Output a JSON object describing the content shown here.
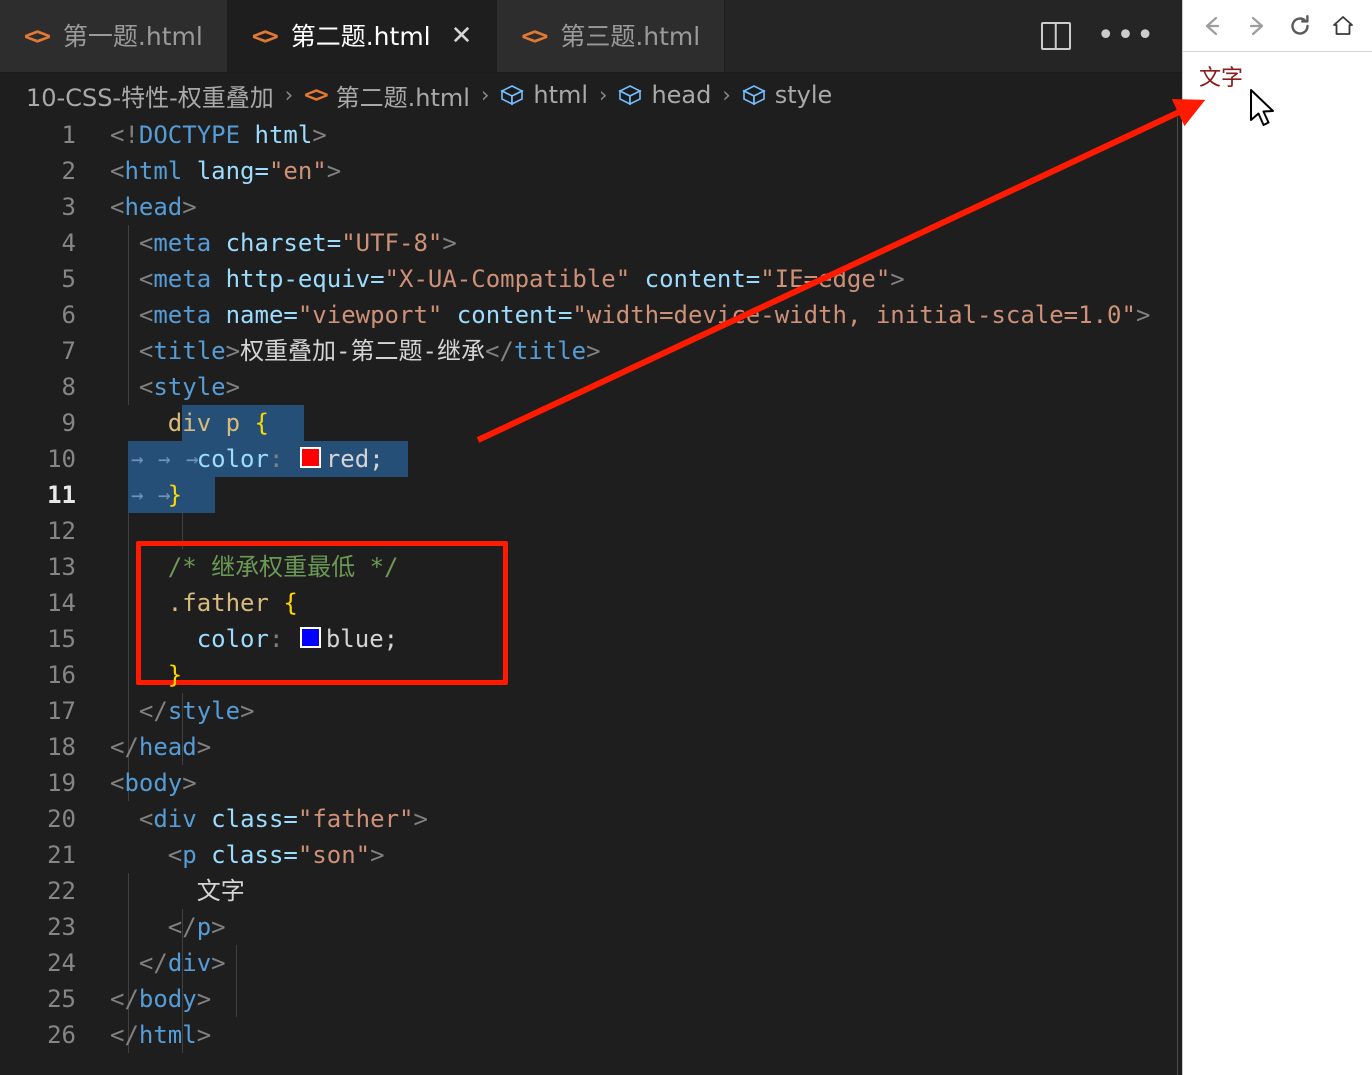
{
  "window": {
    "app": "Visual Studio Code"
  },
  "tabs": [
    {
      "label": "第一题.html",
      "icon": "html-code-icon",
      "active": false,
      "closable": false
    },
    {
      "label": "第二题.html",
      "icon": "html-code-icon",
      "active": true,
      "closable": true,
      "close_label": "✕"
    },
    {
      "label": "第三题.html",
      "icon": "html-code-icon",
      "active": false,
      "closable": false
    }
  ],
  "tabbar_actions": {
    "split_editor_label": "Split Editor",
    "more_actions_label": "•••"
  },
  "breadcrumb": {
    "separator": "›",
    "items": [
      {
        "label": "10-CSS-特性-权重叠加",
        "icon": "folder-icon"
      },
      {
        "label": "第二题.html",
        "icon": "html-code-icon"
      },
      {
        "label": "html",
        "icon": "symbol-cube-icon"
      },
      {
        "label": "head",
        "icon": "symbol-cube-icon"
      },
      {
        "label": "style",
        "icon": "symbol-cube-icon"
      }
    ]
  },
  "editor": {
    "current_line": 11,
    "line_numbers": [
      1,
      2,
      3,
      4,
      5,
      6,
      7,
      8,
      9,
      10,
      11,
      12,
      13,
      14,
      15,
      16,
      17,
      18,
      19,
      20,
      21,
      22,
      23,
      24,
      25,
      26
    ],
    "lines": [
      {
        "n": 1,
        "text": "<!DOCTYPE html>"
      },
      {
        "n": 2,
        "text": "<html lang=\"en\">"
      },
      {
        "n": 3,
        "text": "<head>"
      },
      {
        "n": 4,
        "text": "  <meta charset=\"UTF-8\">"
      },
      {
        "n": 5,
        "text": "  <meta http-equiv=\"X-UA-Compatible\" content=\"IE=edge\">"
      },
      {
        "n": 6,
        "text": "  <meta name=\"viewport\" content=\"width=device-width, initial-scale=1.0\">"
      },
      {
        "n": 7,
        "text": "  <title>权重叠加-第二题-继承</title>"
      },
      {
        "n": 8,
        "text": "  <style>"
      },
      {
        "n": 9,
        "text": "    div p {"
      },
      {
        "n": 10,
        "text": "      color: red;"
      },
      {
        "n": 11,
        "text": "    }"
      },
      {
        "n": 12,
        "text": ""
      },
      {
        "n": 13,
        "text": "    /* 继承权重最低 */"
      },
      {
        "n": 14,
        "text": "    .father {"
      },
      {
        "n": 15,
        "text": "      color: blue;"
      },
      {
        "n": 16,
        "text": "    }"
      },
      {
        "n": 17,
        "text": "  </style>"
      },
      {
        "n": 18,
        "text": "</head>"
      },
      {
        "n": 19,
        "text": "<body>"
      },
      {
        "n": 20,
        "text": "  <div class=\"father\">"
      },
      {
        "n": 21,
        "text": "    <p class=\"son\">"
      },
      {
        "n": 22,
        "text": "      文字"
      },
      {
        "n": 23,
        "text": "    </p>"
      },
      {
        "n": 24,
        "text": "  </div>"
      },
      {
        "n": 25,
        "text": "</body>"
      },
      {
        "n": 26,
        "text": "</html>"
      }
    ],
    "tokens": {
      "doctype_open": "<!",
      "doctype_name": "DOCTYPE",
      "doctype_arg": " html",
      "gt": ">",
      "lt": "<",
      "lt_slash": "</",
      "html": "html",
      "head": "head",
      "body": "body",
      "meta": "meta",
      "title": "title",
      "style": "style",
      "div": "div",
      "p": "p",
      "attr_lang": " lang=",
      "str_en": "\"en\"",
      "attr_charset": " charset=",
      "str_utf8": "\"UTF-8\"",
      "attr_httpequiv": " http-equiv=",
      "str_xua": "\"X-UA-Compatible\"",
      "attr_content": " content=",
      "str_ieedge": "\"IE=edge\"",
      "attr_name": " name=",
      "str_viewport": "\"viewport\"",
      "str_widthdevice": "\"width=device-width, initial-scale=1.0\"",
      "title_text": "权重叠加-第二题-继承",
      "sel_divp": "div p",
      "brace_open": "{",
      "brace_close": "}",
      "prop_color": "color",
      "colon": ": ",
      "val_red": "red;",
      "val_blue": "blue;",
      "comment_father": "/* 继承权重最低 */",
      "sel_father": ".father",
      "attr_class": " class=",
      "str_father": "\"father\"",
      "str_son": "\"son\"",
      "text_wenzi": "文字"
    },
    "colors": {
      "swatch_red": "#ff0000",
      "swatch_blue": "#0000ff",
      "selection": "#264f78",
      "background": "#1e1e1e",
      "annotation_red": "#ff1a00"
    }
  },
  "annotation": {
    "box_label": "highlight-father-rule",
    "arrow_label": "arrow-to-preview-text"
  },
  "browser": {
    "toolbar": [
      {
        "name": "back-icon",
        "glyph": "←"
      },
      {
        "name": "forward-icon",
        "glyph": "→"
      },
      {
        "name": "reload-icon",
        "glyph": "⟳"
      },
      {
        "name": "home-icon",
        "glyph": "⌂"
      }
    ],
    "content": {
      "text": "文字",
      "color": "#8b1a1a"
    }
  }
}
